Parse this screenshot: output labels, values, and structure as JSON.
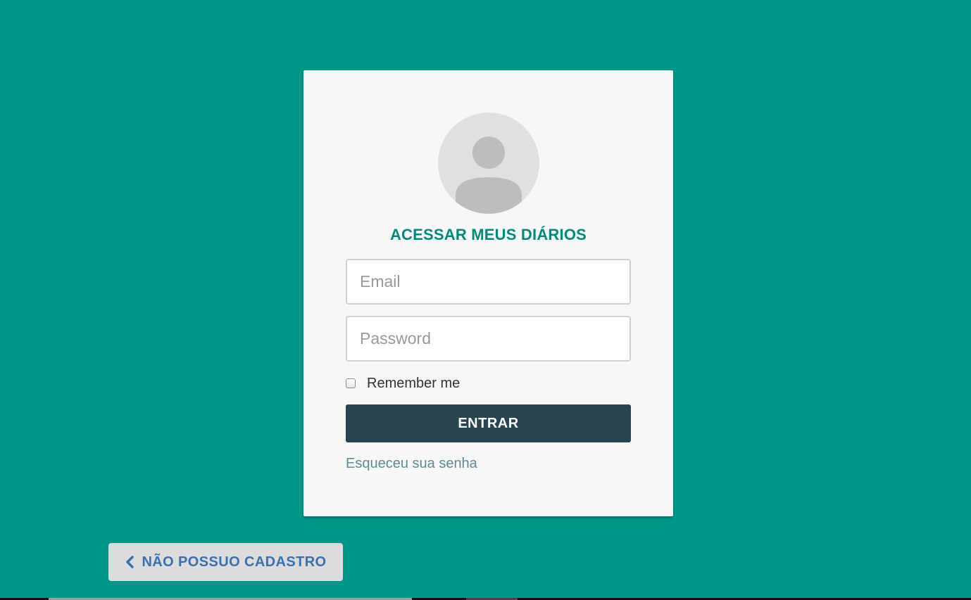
{
  "login": {
    "title": "ACESSAR MEUS DIÁRIOS",
    "email_placeholder": "Email",
    "password_placeholder": "Password",
    "remember_label": "Remember me",
    "remember_checked": false,
    "submit_label": "ENTRAR",
    "forgot_label": "Esqueceu sua senha",
    "avatar_icon": "user-avatar-icon"
  },
  "back": {
    "label": "NÃO POSSUO CADASTRO",
    "icon": "chevron-left-icon"
  },
  "colors": {
    "background": "#009688",
    "card": "#f7f7f7",
    "title": "#00897b",
    "button": "#27444f",
    "link": "#5d8a96",
    "back_button": "#dcdcdc",
    "back_text": "#3a6fb0"
  }
}
